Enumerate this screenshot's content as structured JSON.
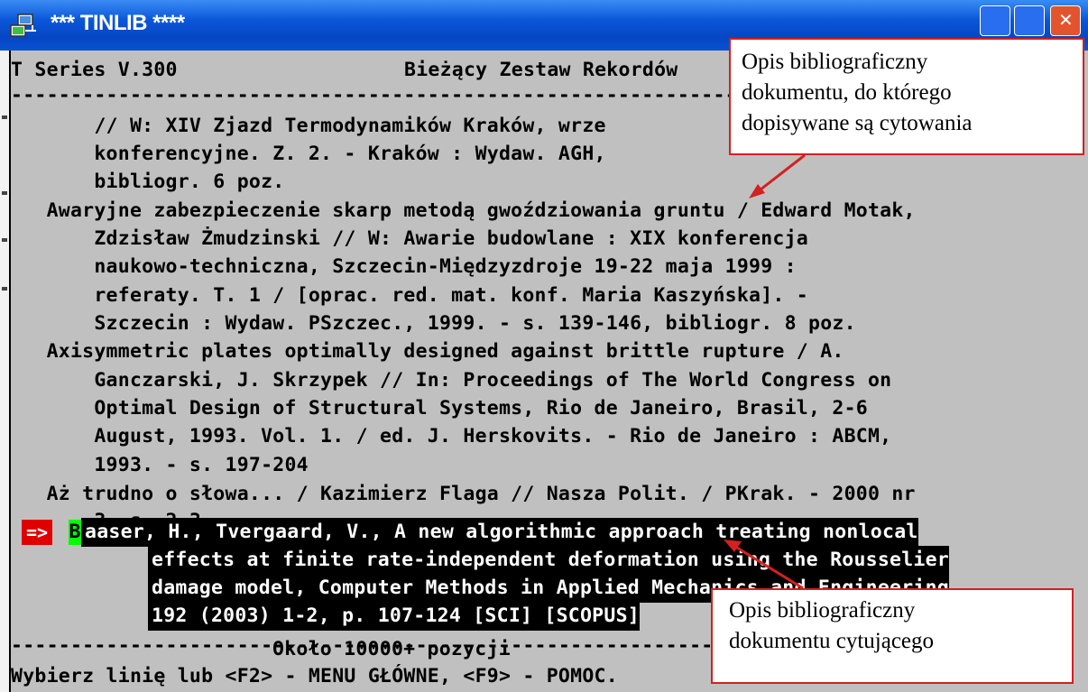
{
  "window": {
    "title": "*** TINLIB ****"
  },
  "header": {
    "left": "T Series V.300",
    "center": "Bieżący Zestaw Rekordów"
  },
  "separator": "-----------------------------------------------------------------------------",
  "records": [
    {
      "line": "       // W: XIV Zjazd Termodynamików Kraków, wrze"
    },
    {
      "line": "       konferencyjne. Z. 2. - Kraków : Wydaw. AGH, "
    },
    {
      "line": "       bibliogr. 6 poz."
    },
    {
      "line": "   Awaryjne zabezpieczenie skarp metodą gwoździowania gruntu / Edward Motak,"
    },
    {
      "line": "       Zdzisław Żmudzinski // W: Awarie budowlane : XIX konferencja"
    },
    {
      "line": "       naukowo-techniczna, Szczecin-Międzyzdroje 19-22 maja 1999 :"
    },
    {
      "line": "       referaty. T. 1 / [oprac. red. mat. konf. Maria Kaszyńska]. -"
    },
    {
      "line": "       Szczecin : Wydaw. PSzczec., 1999. - s. 139-146, bibliogr. 8 poz."
    },
    {
      "line": "   Axisymmetric plates optimally designed against brittle rupture / A."
    },
    {
      "line": "       Ganczarski, J. Skrzypek // In: Proceedings of The World Congress on"
    },
    {
      "line": "       Optimal Design of Structural Systems, Rio de Janeiro, Brasil, 2-6"
    },
    {
      "line": "       August, 1993. Vol. 1. / ed. J. Herskovits. - Rio de Janeiro : ABCM,"
    },
    {
      "line": "       1993. - s. 197-204"
    },
    {
      "line": "   Aż trudno o słowa... / Kazimierz Flaga // Nasza Polit. / PKrak. - 2000 nr"
    },
    {
      "line": "       3, s. 2-3"
    }
  ],
  "selected": {
    "pointer": "=>",
    "first_char": "B",
    "lines": [
      "aaser, H., Tvergaard, V., A new algorithmic approach treating nonlocal",
      "effects at finite rate-independent deformation using the Rousselier",
      "damage model, Computer Methods in Applied Mechanics and Engineering",
      "192 (2003) 1-2, p. 107-124 [SCI] [SCOPUS]"
    ]
  },
  "footer": {
    "count": "Około 10000+ pozycji",
    "prompt": "Wybierz linię lub <F2> - MENU GŁÓWNE, <F9> - POMOC."
  },
  "callouts": {
    "top": [
      "Opis bibliograficzny",
      "dokumentu, do którego",
      "dopisywane są cytowania"
    ],
    "bottom": [
      "Opis bibliograficzny",
      "dokumentu cytującego"
    ]
  },
  "colors": {
    "titlebar": "#0a56d8",
    "console_bg": "#c0c0c0",
    "pointer_bg": "#e00000",
    "cursor_bg": "#00ff00",
    "callout_border": "#d32020"
  }
}
